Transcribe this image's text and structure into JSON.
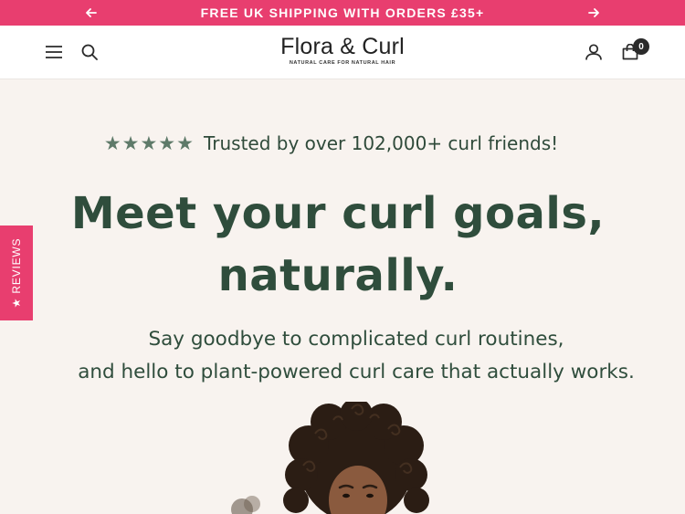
{
  "announcement": {
    "text": "FREE UK SHIPPING WITH ORDERS £35+",
    "prev_icon": "arrow-left-icon",
    "next_icon": "arrow-right-icon"
  },
  "header": {
    "logo_name": "Flora & Curl",
    "logo_tagline": "NATURAL CARE FOR NATURAL HAIR",
    "cart_count": "0",
    "icons": [
      "menu-icon",
      "search-icon",
      "account-icon",
      "cart-icon"
    ]
  },
  "reviews_tab": {
    "label": "★ REVIEWS"
  },
  "hero": {
    "stars": "★★★★★",
    "trust_text": "Trusted by over 102,000+ curl friends!",
    "headline_line1": "Meet your curl goals,",
    "headline_line2": "naturally.",
    "subhead_line1": "Say goodbye to complicated curl routines,",
    "subhead_line2": "and hello to plant-powered curl care that actually works."
  },
  "colors": {
    "accent_pink": "#e83e6f",
    "brand_green": "#2f4d3c",
    "background": "#f8f3ef"
  }
}
